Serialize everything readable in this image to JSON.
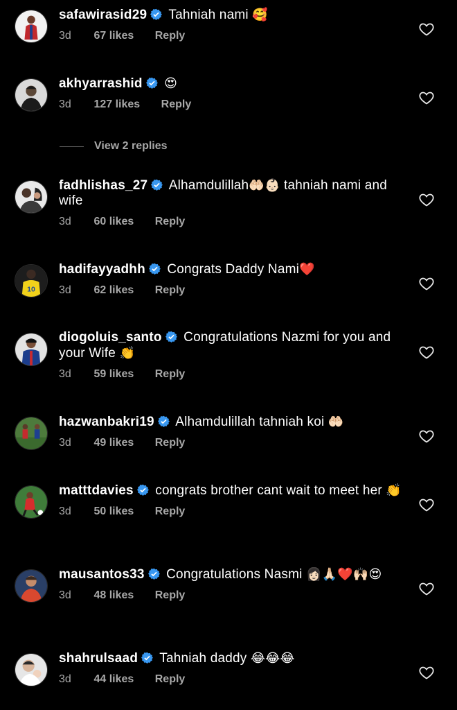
{
  "comments": [
    {
      "username": "safawirasid29",
      "text": "Tahniah nami",
      "emoji": "🥰",
      "text2": "",
      "time": "3d",
      "likes": "67 likes",
      "reply": "Reply"
    },
    {
      "username": "akhyarrashid",
      "text": "",
      "emoji": "😍",
      "text2": "",
      "time": "3d",
      "likes": "127 likes",
      "reply": "Reply"
    },
    {
      "username": "fadhlishas_27",
      "text": "Alhamdulillah",
      "emoji": "🤲🏻👶🏻",
      "text2": "tahniah nami and wife",
      "time": "3d",
      "likes": "60 likes",
      "reply": "Reply"
    },
    {
      "username": "hadifayyadhh",
      "text": "Congrats Daddy Nami",
      "emoji": "❤️",
      "text2": "",
      "time": "3d",
      "likes": "62 likes",
      "reply": "Reply"
    },
    {
      "username": "diogoluis_santo",
      "text": "Congratulations Nazmi for you and your Wife",
      "emoji": "👏",
      "text2": "",
      "time": "3d",
      "likes": "59 likes",
      "reply": "Reply"
    },
    {
      "username": "hazwanbakri19",
      "text": "Alhamdulillah tahniah koi",
      "emoji": "🤲🏻",
      "text2": "",
      "time": "3d",
      "likes": "49 likes",
      "reply": "Reply"
    },
    {
      "username": "matttdavies",
      "text": "congrats brother cant wait to meet her",
      "emoji": "👏",
      "text2": "",
      "time": "3d",
      "likes": "50 likes",
      "reply": "Reply"
    },
    {
      "username": "mausantos33",
      "text": "Congratulations Nasmi",
      "emoji": "👩🏻🙏🏻❤️🙌🏻😍",
      "text2": "",
      "time": "3d",
      "likes": "48 likes",
      "reply": "Reply"
    },
    {
      "username": "shahrulsaad",
      "text": "Tahniah daddy",
      "emoji": "😂😂😂",
      "text2": "",
      "time": "3d",
      "likes": "44 likes",
      "reply": "Reply"
    }
  ],
  "view_replies": "View 2 replies",
  "icons": {
    "verified": "verified-badge-icon",
    "like": "heart-outline-icon"
  },
  "colors": {
    "background": "#000000",
    "secondary_text": "#a8a8a8",
    "verified": "#3897f0"
  }
}
